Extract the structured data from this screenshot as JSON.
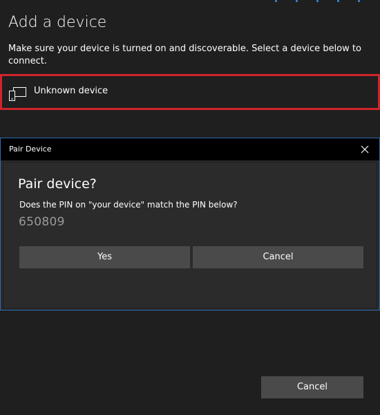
{
  "window": {
    "title": "Add a device",
    "instructions": "Make sure your device is turned on and discoverable. Select a device below to connect."
  },
  "devices": [
    {
      "label": "Unknown device",
      "icon": "device-icon",
      "selected": true,
      "highlight_color": "#d1242b"
    }
  ],
  "pair_dialog": {
    "title": "Pair Device",
    "close_icon": "close-icon",
    "heading": "Pair device?",
    "question": "Does the PIN on \"your device\" match the PIN below?",
    "pin": "650809",
    "yes_label": "Yes",
    "cancel_label": "Cancel",
    "border_color": "#2d6bb5"
  },
  "footer": {
    "cancel_label": "Cancel"
  },
  "colors": {
    "background": "#1f1f1f",
    "dialog_background": "#2b2b2b",
    "button": "#4a4a4a",
    "accent": "#3a8ee6"
  }
}
